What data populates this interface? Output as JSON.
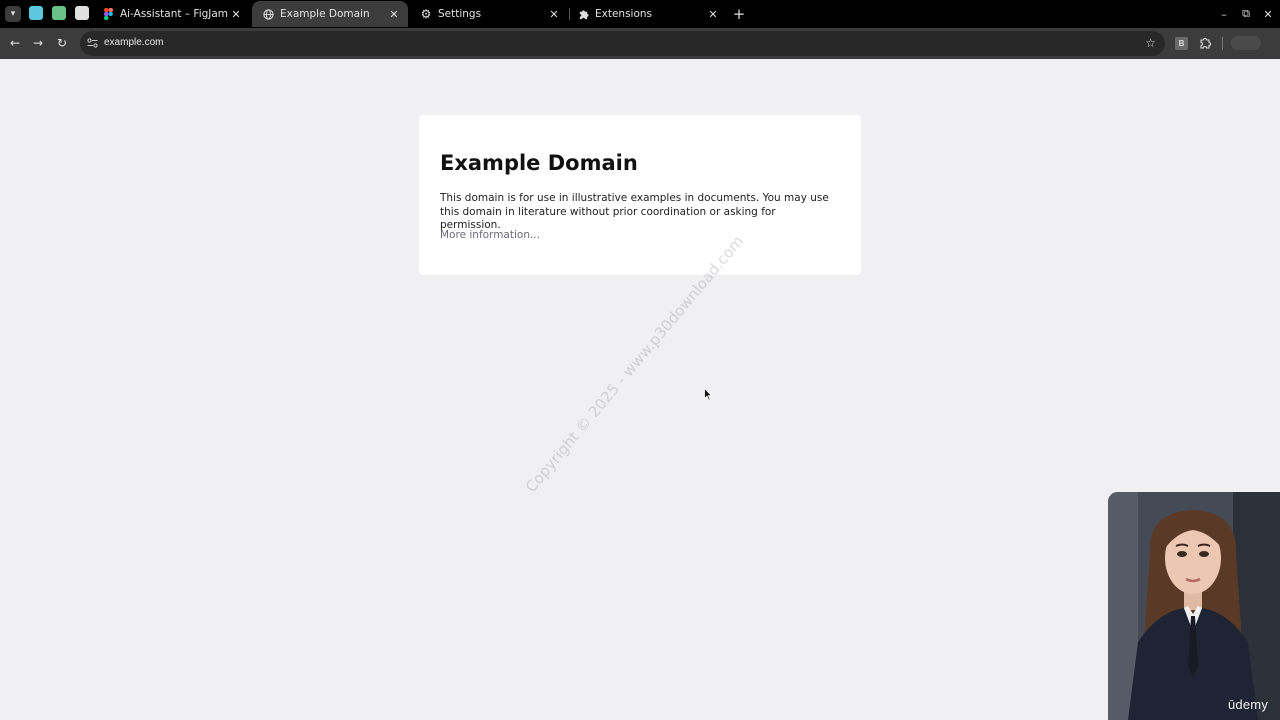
{
  "browser": {
    "tabs": [
      {
        "title": "Ai-Assistant – FigJam",
        "icon": "figma-icon",
        "active": false
      },
      {
        "title": "Example Domain",
        "icon": "globe-icon",
        "active": true
      },
      {
        "title": "Settings",
        "icon": "gear-icon",
        "active": false
      },
      {
        "title": "Extensions",
        "icon": "puzzle-icon",
        "active": false
      }
    ],
    "pinned_tab_colors": [
      "#5bc8e0",
      "#6cc08a",
      "#e0e0e0"
    ],
    "address": "example.com",
    "extension_badge": "B"
  },
  "page": {
    "heading": "Example Domain",
    "description": "This domain is for use in illustrative examples in documents. You may use this domain in literature without prior coordination or asking for permission.",
    "link_text": "More information..."
  },
  "watermark": "Copyright © 2025 - www.p30download.com",
  "overlay": {
    "brand": "ūdemy"
  },
  "colors": {
    "tabstrip": "#000000",
    "toolbar": "#3c3c3c",
    "page_background": "#f0f0f2",
    "card": "#ffffff"
  }
}
